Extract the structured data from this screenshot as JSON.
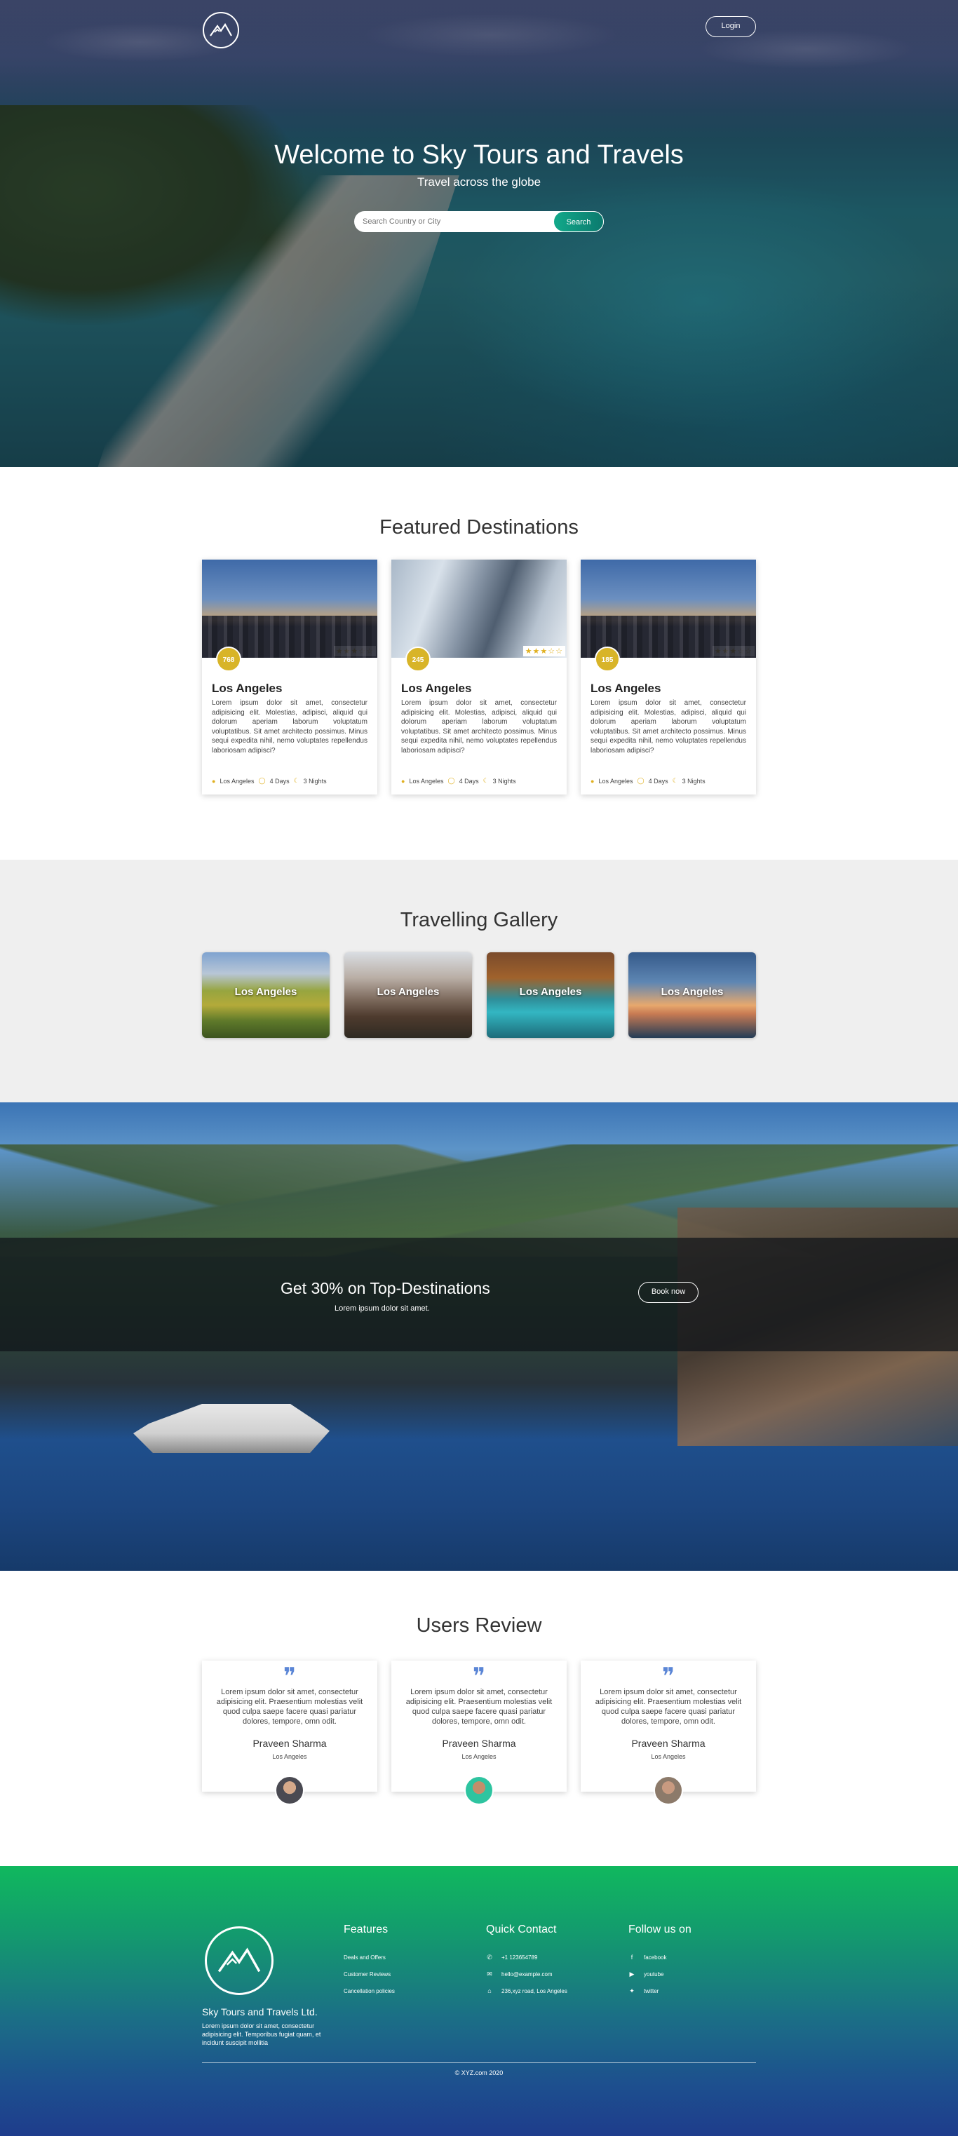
{
  "header": {
    "login_label": "Login"
  },
  "hero": {
    "title": "Welcome to Sky Tours and Travels",
    "subtitle": "Travel across the globe",
    "search_placeholder": "Search Country or City",
    "search_label": "Search"
  },
  "featured": {
    "title": "Featured Destinations",
    "cards": [
      {
        "badge": "768",
        "rating": "★★★☆☆",
        "name": "Los Angeles",
        "text": "Lorem ipsum dolor sit amet, consectetur adipisicing elit. Molestias, adipisci, aliquid qui dolorum aperiam laborum voluptatum voluptatibus. Sit amet architecto possimus. Minus sequi expedita nihil, nemo voluptates repellendus laboriosam adipisci?",
        "place": "Los Angeles",
        "days": "4 Days",
        "nights": "3 Nights"
      },
      {
        "badge": "245",
        "rating": "★★★☆☆",
        "name": "Los Angeles",
        "text": "Lorem ipsum dolor sit amet, consectetur adipisicing elit. Molestias, adipisci, aliquid qui dolorum aperiam laborum voluptatum voluptatibus. Sit amet architecto possimus. Minus sequi expedita nihil, nemo voluptates repellendus laboriosam adipisci?",
        "place": "Los Angeles",
        "days": "4 Days",
        "nights": "3 Nights"
      },
      {
        "badge": "185",
        "rating": "★★★☆☆",
        "name": "Los Angeles",
        "text": "Lorem ipsum dolor sit amet, consectetur adipisicing elit. Molestias, adipisci, aliquid qui dolorum aperiam laborum voluptatum voluptatibus. Sit amet architecto possimus. Minus sequi expedita nihil, nemo voluptates repellendus laboriosam adipisci?",
        "place": "Los Angeles",
        "days": "4 Days",
        "nights": "3 Nights"
      }
    ]
  },
  "gallery": {
    "title": "Travelling Gallery",
    "items": [
      {
        "label": "Los Angeles"
      },
      {
        "label": "Los Angeles"
      },
      {
        "label": "Los Angeles"
      },
      {
        "label": "Los Angeles"
      }
    ]
  },
  "promo": {
    "title": "Get 30% on Top-Destinations",
    "subtitle": "Lorem ipsum dolor sit amet.",
    "button": "Book now"
  },
  "reviews": {
    "title": "Users Review",
    "items": [
      {
        "text": "Lorem ipsum dolor sit amet, consectetur adipisicing elit. Praesentium molestias velit quod culpa saepe facere quasi pariatur dolores, tempore, omn odit.",
        "name": "Praveen Sharma",
        "location": "Los Angeles"
      },
      {
        "text": "Lorem ipsum dolor sit amet, consectetur adipisicing elit. Praesentium molestias velit quod culpa saepe facere quasi pariatur dolores, tempore, omn odit.",
        "name": "Praveen Sharma",
        "location": "Los Angeles"
      },
      {
        "text": "Lorem ipsum dolor sit amet, consectetur adipisicing elit. Praesentium molestias velit quod culpa saepe facere quasi pariatur dolores, tempore, omn odit.",
        "name": "Praveen Sharma",
        "location": "Los Angeles"
      }
    ]
  },
  "footer": {
    "company": "Sky Tours and Travels Ltd.",
    "description": "Lorem ipsum dolor sit amet, consectetur adipisicing elit. Temporibus fugiat quam, et incidunt suscipit mollitia",
    "features": {
      "title": "Features",
      "items": [
        "Deals and Offers",
        "Customer Reviews",
        "Cancellation policies"
      ]
    },
    "contact": {
      "title": "Quick Contact",
      "phone": "+1 123654789",
      "email": "hello@example.com",
      "address": "236,xyz road, Los Angeles"
    },
    "follow": {
      "title": "Follow us on",
      "facebook": "facebook",
      "youtube": "youtube",
      "twitter": "twitter"
    },
    "copyright": "© XYZ.com 2020"
  },
  "colors": {
    "accent_gold": "#d8b428",
    "search_green": "#12a98a",
    "quote_blue": "#5b86d6",
    "footer_top": "#10b85e",
    "footer_bottom": "#1e3b8c"
  }
}
